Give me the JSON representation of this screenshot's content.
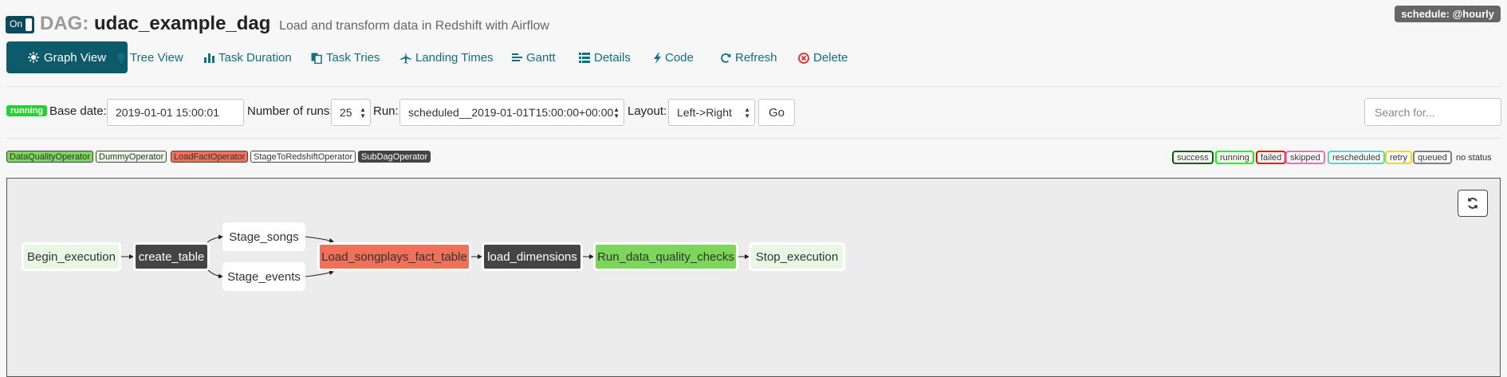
{
  "header": {
    "toggle_label": "On",
    "dag_label": "DAG:",
    "dag_id": "udac_example_dag",
    "description": "Load and transform data in Redshift with Airflow",
    "schedule": "schedule: @hourly"
  },
  "nav": {
    "items": [
      {
        "label": "Graph View",
        "icon": "sun-icon"
      },
      {
        "label": "Tree View",
        "icon": "tree-icon"
      },
      {
        "label": "Task Duration",
        "icon": "bar-chart-icon"
      },
      {
        "label": "Task Tries",
        "icon": "copy-icon"
      },
      {
        "label": "Landing Times",
        "icon": "plane-icon"
      },
      {
        "label": "Gantt",
        "icon": "gantt-icon"
      },
      {
        "label": "Details",
        "icon": "list-icon"
      },
      {
        "label": "Code",
        "icon": "flash-icon"
      },
      {
        "label": "Refresh",
        "icon": "refresh-icon"
      },
      {
        "label": "Delete",
        "icon": "remove-circle-icon"
      }
    ],
    "active": "Graph View"
  },
  "controls": {
    "state": "running",
    "base_date_label": "Base date:",
    "base_date": "2019-01-01 15:00:01",
    "runs_label": "Number of runs:",
    "runs": "25",
    "run_label": "Run:",
    "run": "scheduled__2019-01-01T15:00:00+00:00",
    "layout_label": "Layout:",
    "layout": "Left->Right",
    "go_label": "Go",
    "search_placeholder": "Search for..."
  },
  "operators": [
    {
      "label": "DataQualityOperator",
      "color": "#7bd65a"
    },
    {
      "label": "DummyOperator",
      "color": "#e8f7e4"
    },
    {
      "label": "LoadFactOperator",
      "color": "#f0705a"
    },
    {
      "label": "StageToRedshiftOperator",
      "color": "#ffffff"
    },
    {
      "label": "SubDagOperator",
      "color": "#444444"
    }
  ],
  "states": [
    {
      "label": "success",
      "color": "#006400"
    },
    {
      "label": "running",
      "color": "#00ff00"
    },
    {
      "label": "failed",
      "color": "#ff0000"
    },
    {
      "label": "skipped",
      "color": "#ff69b4"
    },
    {
      "label": "rescheduled",
      "color": "#40e0d0"
    },
    {
      "label": "retry",
      "color": "#ffd700"
    },
    {
      "label": "queued",
      "color": "#808080"
    },
    {
      "label": "no status",
      "color": "#ffffff"
    }
  ],
  "graph": {
    "nodes": [
      {
        "id": "Begin_execution",
        "operator": "DummyOperator"
      },
      {
        "id": "create_table",
        "operator": "SubDagOperator"
      },
      {
        "id": "Stage_songs",
        "operator": "StageToRedshiftOperator"
      },
      {
        "id": "Stage_events",
        "operator": "StageToRedshiftOperator"
      },
      {
        "id": "Load_songplays_fact_table",
        "operator": "LoadFactOperator"
      },
      {
        "id": "load_dimensions",
        "operator": "SubDagOperator"
      },
      {
        "id": "Run_data_quality_checks",
        "operator": "DataQualityOperator"
      },
      {
        "id": "Stop_execution",
        "operator": "DummyOperator"
      }
    ]
  }
}
